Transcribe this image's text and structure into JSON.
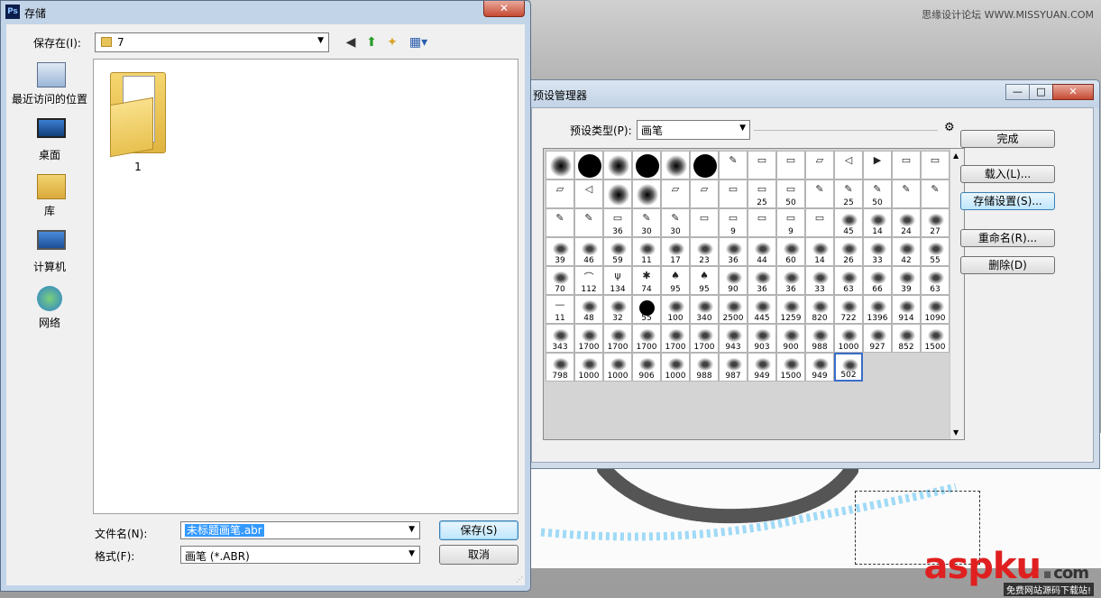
{
  "watermark": {
    "site": "思缘设计论坛 WWW.MISSYUAN.COM",
    "logo_main": "aspku",
    "logo_dot": ".",
    "logo_com": "com",
    "logo_sub": "免费网站源码下载站!"
  },
  "preset_manager": {
    "title": "预设管理器",
    "type_label": "预设类型(P):",
    "type_value": "画笔",
    "buttons": {
      "done": "完成",
      "load": "载入(L)...",
      "save_set": "存储设置(S)...",
      "rename": "重命名(R)...",
      "delete": "删除(D)"
    },
    "brushes": [
      {
        "k": "soft",
        "n": ""
      },
      {
        "k": "hard",
        "n": ""
      },
      {
        "k": "soft",
        "n": ""
      },
      {
        "k": "hard",
        "n": ""
      },
      {
        "k": "soft",
        "n": ""
      },
      {
        "k": "hard",
        "n": ""
      },
      {
        "k": "glyph",
        "n": "",
        "g": "✎"
      },
      {
        "k": "glyph",
        "n": "",
        "g": "▭"
      },
      {
        "k": "glyph",
        "n": "",
        "g": "▭"
      },
      {
        "k": "glyph",
        "n": "",
        "g": "▱"
      },
      {
        "k": "glyph",
        "n": "",
        "g": "◁"
      },
      {
        "k": "glyph",
        "n": "",
        "g": "▶"
      },
      {
        "k": "glyph",
        "n": "",
        "g": "▭"
      },
      {
        "k": "glyph",
        "n": "",
        "g": "▭"
      },
      {
        "k": "glyph",
        "n": "",
        "g": "▱"
      },
      {
        "k": "glyph",
        "n": "",
        "g": "◁"
      },
      {
        "k": "soft",
        "n": ""
      },
      {
        "k": "soft",
        "n": ""
      },
      {
        "k": "glyph",
        "n": "",
        "g": "▱"
      },
      {
        "k": "glyph",
        "n": "",
        "g": "▱"
      },
      {
        "k": "glyph",
        "n": "",
        "g": "▭"
      },
      {
        "k": "glyph",
        "n": "25",
        "g": "▭"
      },
      {
        "k": "glyph",
        "n": "50",
        "g": "▭"
      },
      {
        "k": "glyph",
        "n": "",
        "g": "✎"
      },
      {
        "k": "glyph",
        "n": "25",
        "g": "✎"
      },
      {
        "k": "glyph",
        "n": "50",
        "g": "✎"
      },
      {
        "k": "glyph",
        "n": "",
        "g": "✎"
      },
      {
        "k": "glyph",
        "n": "",
        "g": "✎"
      },
      {
        "k": "glyph",
        "n": "",
        "g": "✎"
      },
      {
        "k": "glyph",
        "n": "",
        "g": "✎"
      },
      {
        "k": "glyph",
        "n": "36",
        "g": "▭"
      },
      {
        "k": "glyph",
        "n": "30",
        "g": "✎"
      },
      {
        "k": "glyph",
        "n": "30",
        "g": "✎"
      },
      {
        "k": "glyph",
        "n": "",
        "g": "▭"
      },
      {
        "k": "glyph",
        "n": "9",
        "g": "▭"
      },
      {
        "k": "glyph",
        "n": "",
        "g": "▭"
      },
      {
        "k": "glyph",
        "n": "9",
        "g": "▭"
      },
      {
        "k": "glyph",
        "n": "",
        "g": "▭"
      },
      {
        "k": "ink",
        "n": "45"
      },
      {
        "k": "ink",
        "n": "14"
      },
      {
        "k": "ink",
        "n": "24"
      },
      {
        "k": "ink",
        "n": "27"
      },
      {
        "k": "ink",
        "n": "39"
      },
      {
        "k": "ink",
        "n": "46"
      },
      {
        "k": "ink",
        "n": "59"
      },
      {
        "k": "ink",
        "n": "11"
      },
      {
        "k": "ink",
        "n": "17"
      },
      {
        "k": "ink",
        "n": "23"
      },
      {
        "k": "ink",
        "n": "36"
      },
      {
        "k": "ink",
        "n": "44"
      },
      {
        "k": "ink",
        "n": "60"
      },
      {
        "k": "ink",
        "n": "14"
      },
      {
        "k": "ink",
        "n": "26"
      },
      {
        "k": "ink",
        "n": "33"
      },
      {
        "k": "ink",
        "n": "42"
      },
      {
        "k": "ink",
        "n": "55"
      },
      {
        "k": "ink",
        "n": "70"
      },
      {
        "k": "glyph",
        "n": "112",
        "g": "⌒"
      },
      {
        "k": "glyph",
        "n": "134",
        "g": "ψ"
      },
      {
        "k": "glyph",
        "n": "74",
        "g": "✱"
      },
      {
        "k": "glyph",
        "n": "95",
        "g": "♠"
      },
      {
        "k": "glyph",
        "n": "95",
        "g": "♠"
      },
      {
        "k": "ink",
        "n": "90"
      },
      {
        "k": "ink",
        "n": "36"
      },
      {
        "k": "ink",
        "n": "36"
      },
      {
        "k": "ink",
        "n": "33"
      },
      {
        "k": "ink",
        "n": "63"
      },
      {
        "k": "ink",
        "n": "66"
      },
      {
        "k": "ink",
        "n": "39"
      },
      {
        "k": "ink",
        "n": "63"
      },
      {
        "k": "glyph",
        "n": "11",
        "g": "—"
      },
      {
        "k": "ink",
        "n": "48"
      },
      {
        "k": "ink",
        "n": "32"
      },
      {
        "k": "hardsm",
        "n": "55"
      },
      {
        "k": "ink",
        "n": "100"
      },
      {
        "k": "ink",
        "n": "340"
      },
      {
        "k": "ink",
        "n": "2500"
      },
      {
        "k": "ink",
        "n": "445"
      },
      {
        "k": "ink",
        "n": "1259"
      },
      {
        "k": "ink",
        "n": "820"
      },
      {
        "k": "ink",
        "n": "722"
      },
      {
        "k": "ink",
        "n": "1396"
      },
      {
        "k": "ink",
        "n": "914"
      },
      {
        "k": "ink",
        "n": "1090"
      },
      {
        "k": "ink",
        "n": "343"
      },
      {
        "k": "ink",
        "n": "1700"
      },
      {
        "k": "ink",
        "n": "1700"
      },
      {
        "k": "ink",
        "n": "1700"
      },
      {
        "k": "ink",
        "n": "1700"
      },
      {
        "k": "ink",
        "n": "1700"
      },
      {
        "k": "ink",
        "n": "943"
      },
      {
        "k": "ink",
        "n": "903"
      },
      {
        "k": "ink",
        "n": "900"
      },
      {
        "k": "ink",
        "n": "988"
      },
      {
        "k": "ink",
        "n": "1000"
      },
      {
        "k": "ink",
        "n": "927"
      },
      {
        "k": "ink",
        "n": "852"
      },
      {
        "k": "ink",
        "n": "1500"
      },
      {
        "k": "ink",
        "n": "798"
      },
      {
        "k": "ink",
        "n": "1000"
      },
      {
        "k": "ink",
        "n": "1000"
      },
      {
        "k": "ink",
        "n": "906"
      },
      {
        "k": "ink",
        "n": "1000"
      },
      {
        "k": "ink",
        "n": "988"
      },
      {
        "k": "ink",
        "n": "987"
      },
      {
        "k": "ink",
        "n": "949"
      },
      {
        "k": "ink",
        "n": "1500"
      },
      {
        "k": "ink",
        "n": "949"
      },
      {
        "k": "ink",
        "n": "502",
        "sel": true
      }
    ]
  },
  "save_dialog": {
    "title": "存储",
    "app_icon": "Ps",
    "close_label": "✕",
    "save_in_label": "保存在(I):",
    "save_in_value": "7",
    "places": [
      {
        "label": "最近访问的位置",
        "icon": "recent-places-icon"
      },
      {
        "label": "桌面",
        "icon": "desktop-icon"
      },
      {
        "label": "库",
        "icon": "libraries-icon"
      },
      {
        "label": "计算机",
        "icon": "computer-icon"
      },
      {
        "label": "网络",
        "icon": "network-icon"
      }
    ],
    "folder_name": "1",
    "file_name_label": "文件名(N):",
    "file_name_value": "未标题画笔.abr",
    "format_label": "格式(F):",
    "format_value": "画笔 (*.ABR)",
    "save_button": "保存(S)",
    "cancel_button": "取消"
  }
}
